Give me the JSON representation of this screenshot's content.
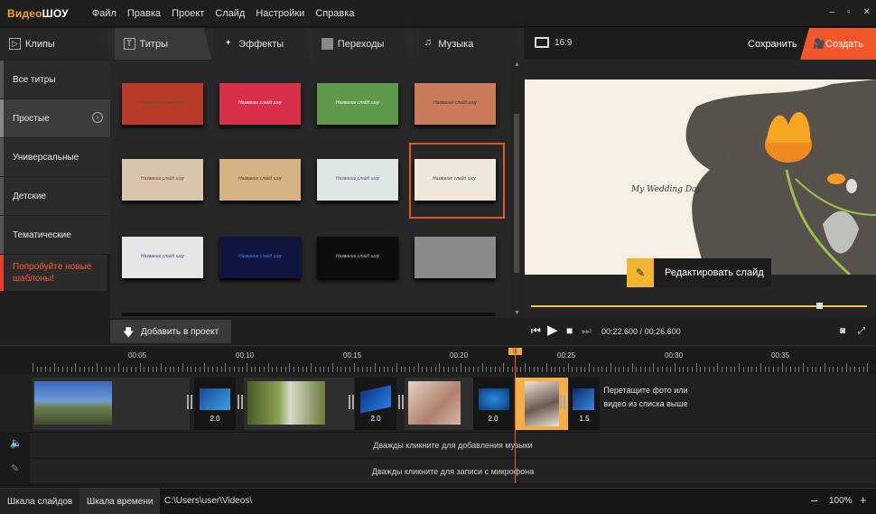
{
  "app": {
    "logo_part1": "Видео",
    "logo_part2": "ШОУ",
    "menu": [
      "Файл",
      "Правка",
      "Проект",
      "Слайд",
      "Настройки",
      "Справка"
    ],
    "window_buttons": [
      "–",
      "▫",
      "✕"
    ]
  },
  "tabs": [
    {
      "label": "Клипы",
      "icon": "play-icon"
    },
    {
      "label": "Титры",
      "icon": "text-icon"
    },
    {
      "label": "Эффекты",
      "icon": "magic-wand-icon"
    },
    {
      "label": "Переходы",
      "icon": "film-icon"
    },
    {
      "label": "Музыка",
      "icon": "music-icon"
    }
  ],
  "categories": [
    {
      "label": "Все титры"
    },
    {
      "label": "Простые"
    },
    {
      "label": "Универсальные"
    },
    {
      "label": "Детские"
    },
    {
      "label": "Тематические"
    },
    {
      "label": "Попробуйте новые шаблоны!"
    }
  ],
  "thumbnails": [
    {
      "text": "Название слайд шоу",
      "bg": "#b83a28",
      "color": "#553"
    },
    {
      "text": "Название слайд шоу",
      "bg": "#d8304a",
      "color": "#fff"
    },
    {
      "text": "Название слайд шоу",
      "bg": "#5f9a4c",
      "color": "#fff"
    },
    {
      "text": "Название слайд шоу",
      "bg": "#c87a5a",
      "color": "#333"
    },
    {
      "text": "Название слайд шоу",
      "bg": "#d9c4ae",
      "color": "#6a4a3a"
    },
    {
      "text": "Название слайд шоу",
      "bg": "#d6b184",
      "color": "#5a3a20"
    },
    {
      "text": "Название слайд шоу",
      "bg": "#dfe6e6",
      "color": "#557"
    },
    {
      "text": "Название слайд шоу",
      "bg": "#efe7dc",
      "color": "#444"
    },
    {
      "text": "Название слайд шоу",
      "bg": "#e6e6e6",
      "color": "#448"
    },
    {
      "text": "Название слайд шоу",
      "bg": "#0f1640",
      "color": "#4a7ae0"
    },
    {
      "text": "Название слайд шоу",
      "bg": "#0d0d0d",
      "color": "#bbb"
    },
    {
      "text": "",
      "bg": "#8a8a8a",
      "color": "#fff"
    }
  ],
  "add_to_project": "Добавить в проект",
  "preview": {
    "ratio": "16:9",
    "save": "Сохранить",
    "create": "Создать",
    "slide_title": "My Wedding Day",
    "edit_slide": "Редактировать слайд",
    "progress": 0.857,
    "time_current": "00:22.600",
    "time_total": "00:26.600"
  },
  "ruler": {
    "labels": [
      "00:05",
      "00:10",
      "00:15",
      "00:20",
      "00:25",
      "00:30",
      "00:35"
    ]
  },
  "timeline": {
    "transitions": [
      "2.0",
      "2.0",
      "2.0",
      "1.5"
    ],
    "drop_hint": "Перетащите фото или видео из списка выше",
    "music_hint": "Дважды кликните для добавления музыки",
    "mic_hint": "Дважды кликните для записи с микрофона"
  },
  "status": {
    "tab_slides": "Шкала слайдов",
    "tab_timeline": "Шкала времени",
    "path": "C:\\Users\\user\\Videos\\",
    "zoom": "100%"
  },
  "colors": {
    "accent": "#f0572a",
    "edit_icon_bg": "#f2b533",
    "promo": "#ff5a36"
  }
}
